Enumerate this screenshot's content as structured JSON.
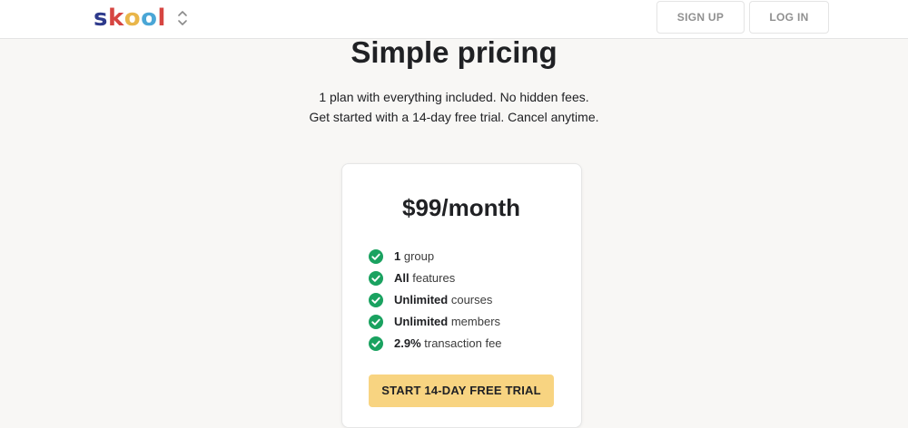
{
  "header": {
    "logo_letters": [
      {
        "char": "s",
        "color": "#2e3a8c"
      },
      {
        "char": "k",
        "color": "#d64541"
      },
      {
        "char": "o",
        "color": "#e9b64a"
      },
      {
        "char": "o",
        "color": "#4aa6d6"
      },
      {
        "char": "l",
        "color": "#d64541"
      }
    ],
    "switcher_icon": "chevron-up-down-icon",
    "signup_label": "SIGN UP",
    "login_label": "LOG IN"
  },
  "main": {
    "title": "Simple pricing",
    "subtitle_line1": "1 plan with everything included. No hidden fees.",
    "subtitle_line2": "Get started with a 14-day free trial. Cancel anytime."
  },
  "plan": {
    "price": "$99/month",
    "features": [
      {
        "bold": "1",
        "rest": " group"
      },
      {
        "bold": "All",
        "rest": " features"
      },
      {
        "bold": "Unlimited",
        "rest": " courses"
      },
      {
        "bold": "Unlimited",
        "rest": " members"
      },
      {
        "bold": "2.9%",
        "rest": " transaction fee"
      }
    ],
    "check_icon": "check-circle-icon",
    "check_color": "#1aa260",
    "cta_label": "START 14-DAY FREE TRIAL",
    "cta_color": "#f8d481"
  }
}
